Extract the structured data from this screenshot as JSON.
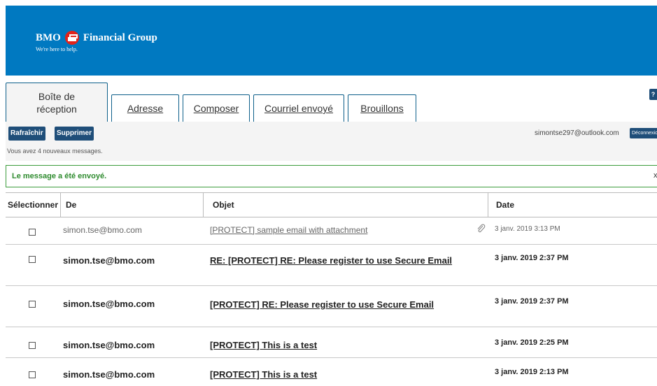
{
  "header": {
    "bank": "BMO",
    "group": "Financial Group",
    "tagline": "We're here to help."
  },
  "tabs": [
    {
      "label": "Boîte de réception",
      "active": true
    },
    {
      "label": "Adresse"
    },
    {
      "label": "Composer"
    },
    {
      "label": "Courriel envoyé"
    },
    {
      "label": "Brouillons"
    }
  ],
  "help_label": "?",
  "toolbar": {
    "refresh_label": "Rafraîchir",
    "delete_label": "Supprimer",
    "new_messages": "Vous avez 4 nouveaux messages.",
    "account_email": "simontse297@outlook.com",
    "logout_label": "Déconnexion"
  },
  "alert": {
    "text": "Le message a été envoyé.",
    "close": "x",
    "color": "#2e8b2e"
  },
  "table": {
    "headers": {
      "select": "Sélectionner",
      "from": "De",
      "subject": "Objet",
      "date": "Date"
    },
    "rows": [
      {
        "from": "simon.tse@bmo.com",
        "subject": "[PROTECT] sample email with attachment",
        "date": "3 janv. 2019 3:13 PM",
        "unread": false,
        "attachment": true
      },
      {
        "from": "simon.tse@bmo.com",
        "subject": "RE: [PROTECT] RE: Please register to use Secure Email",
        "date": "3 janv. 2019 2:37 PM",
        "unread": true
      },
      {
        "from": "simon.tse@bmo.com",
        "subject": "[PROTECT] RE: Please register to use Secure Email",
        "date": "3 janv. 2019 2:37 PM",
        "unread": true
      },
      {
        "from": "simon.tse@bmo.com",
        "subject": "[PROTECT] This is a test",
        "date": "3 janv. 2019 2:25 PM",
        "unread": true
      },
      {
        "from": "simon.tse@bmo.com",
        "subject": "[PROTECT] This is a test",
        "date": "3 janv. 2019 2:13 PM",
        "unread": true
      }
    ]
  },
  "colors": {
    "header": "#0079c1",
    "button": "#1f4e79",
    "logo_red": "#e2231a"
  }
}
